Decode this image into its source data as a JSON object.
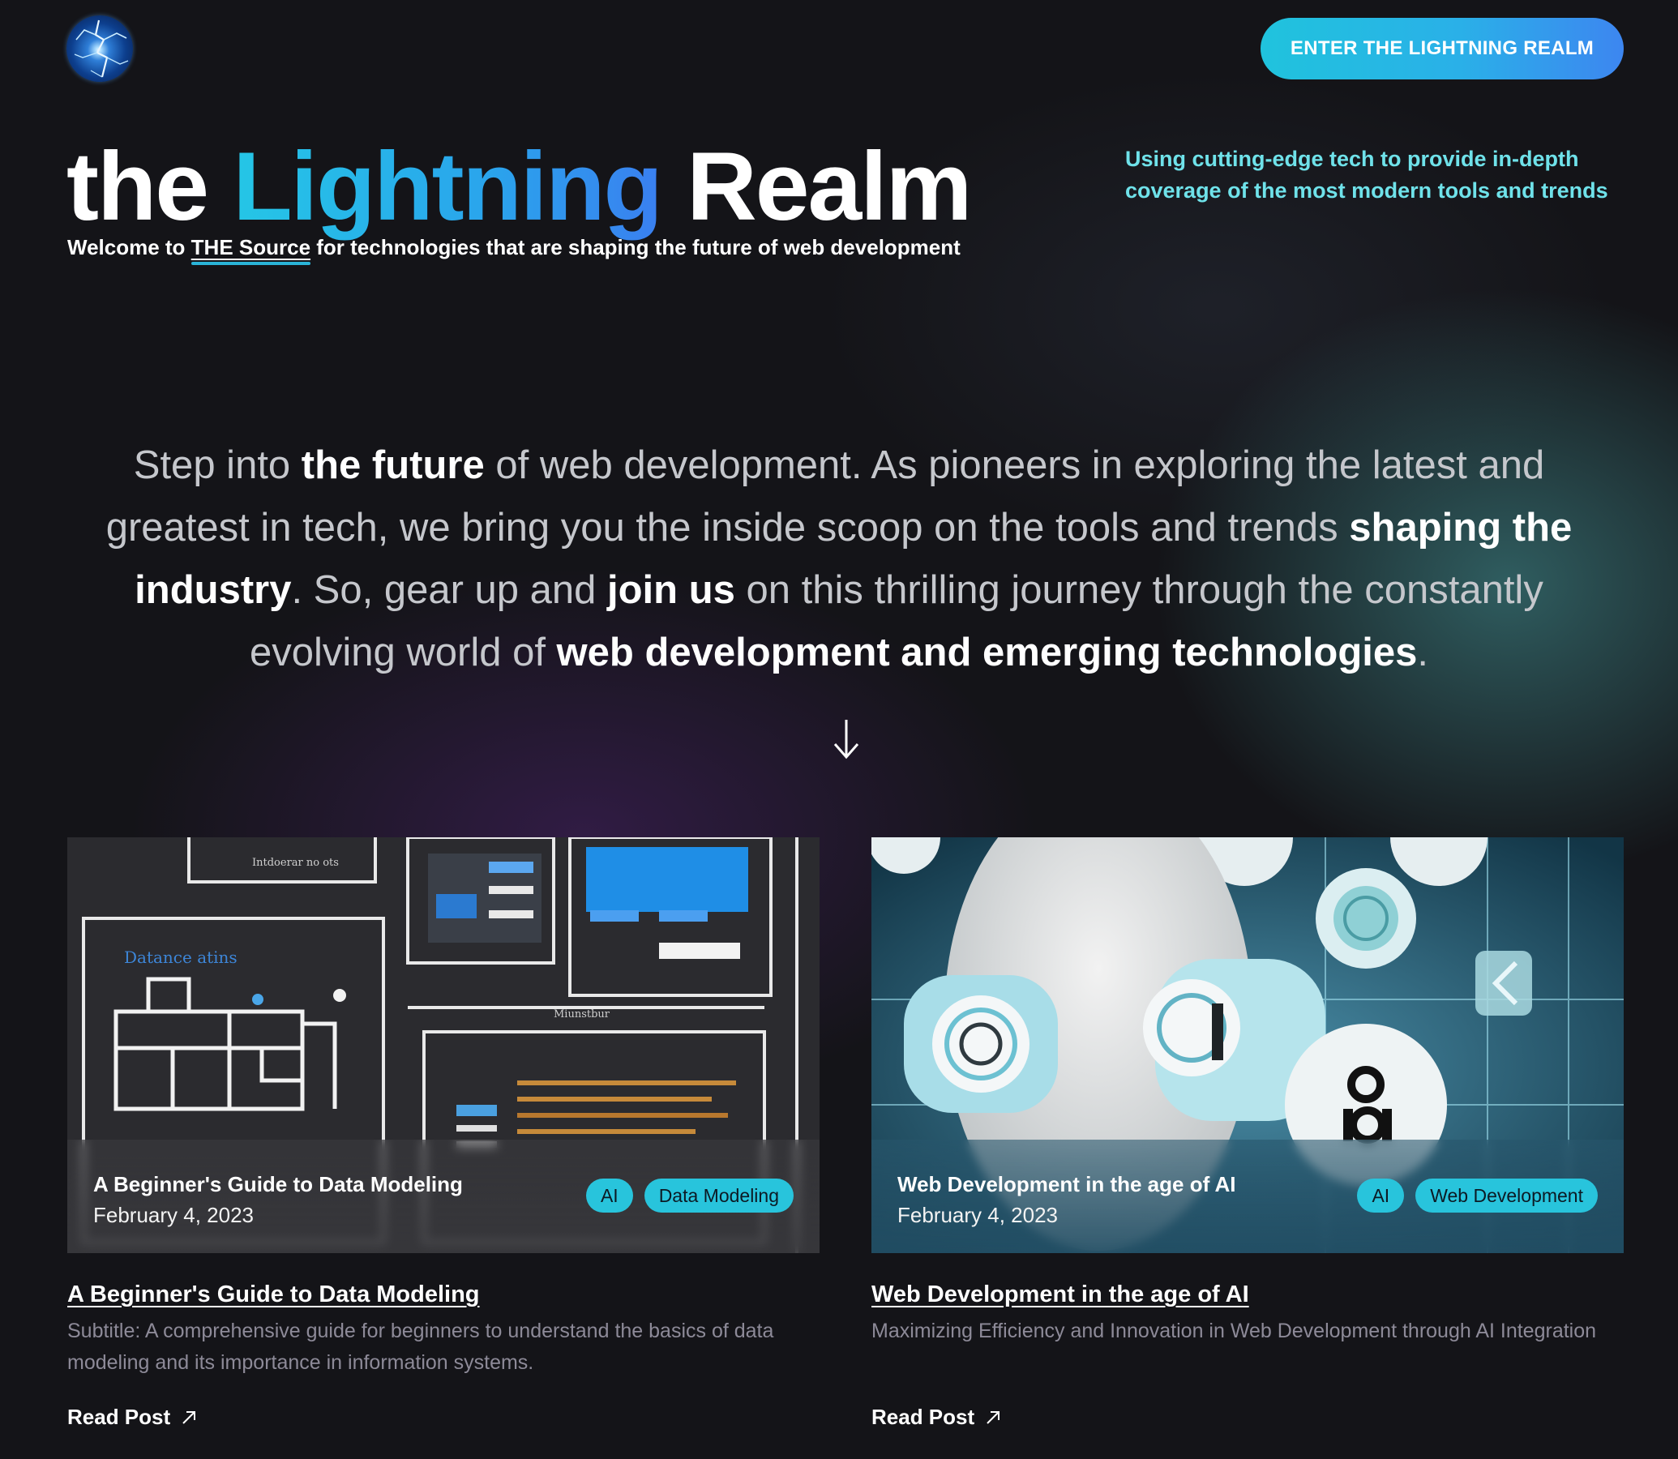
{
  "header": {
    "logo_name": "lightning-orb-logo",
    "cta_label": "ENTER THE LIGHTNING REALM"
  },
  "hero": {
    "title_pre": "the ",
    "title_accent": "Lightning",
    "title_post": " Realm",
    "subtitle_pre": "Welcome to ",
    "subtitle_link": "THE Source",
    "subtitle_post": " for technologies that are shaping the future of web development",
    "tagline": "Using cutting-edge tech to provide in-depth coverage of the most modern tools and trends"
  },
  "intro": {
    "p1": "Step into ",
    "b1": "the future",
    "p2": " of web development. As pioneers in exploring the latest and greatest in tech, we bring you the inside scoop on the tools and trends ",
    "b2": "shaping the industry",
    "p3": ". So, gear up and ",
    "b3": "join us",
    "p4": " on this thrilling journey through the constantly evolving world of ",
    "b4": "web development and emerging technologies",
    "p5": "."
  },
  "scroll_icon": "arrow-down-icon",
  "posts": [
    {
      "overlay_title": "A Beginner's Guide to Data Modeling",
      "date": "February 4, 2023",
      "tags": [
        "AI",
        "Data Modeling"
      ],
      "title": "A Beginner's Guide to Data Modeling",
      "subtitle": "Subtitle: A comprehensive guide for beginners to understand the basics of data modeling and its importance in information systems.",
      "read_label": "Read Post",
      "thumb_text": [
        "Datance atins",
        "Miunstbur",
        "Intdoerar no ots"
      ]
    },
    {
      "overlay_title": "Web Development in the age of AI",
      "date": "February 4, 2023",
      "tags": [
        "AI",
        "Web Development"
      ],
      "title": "Web Development in the age of AI",
      "subtitle": "Maximizing Efficiency and Innovation in Web Development through AI Integration",
      "read_label": "Read Post"
    }
  ],
  "colors": {
    "accent_cyan": "#28c4dc",
    "tagline_cyan": "#6fe2ea",
    "background": "#141418"
  }
}
